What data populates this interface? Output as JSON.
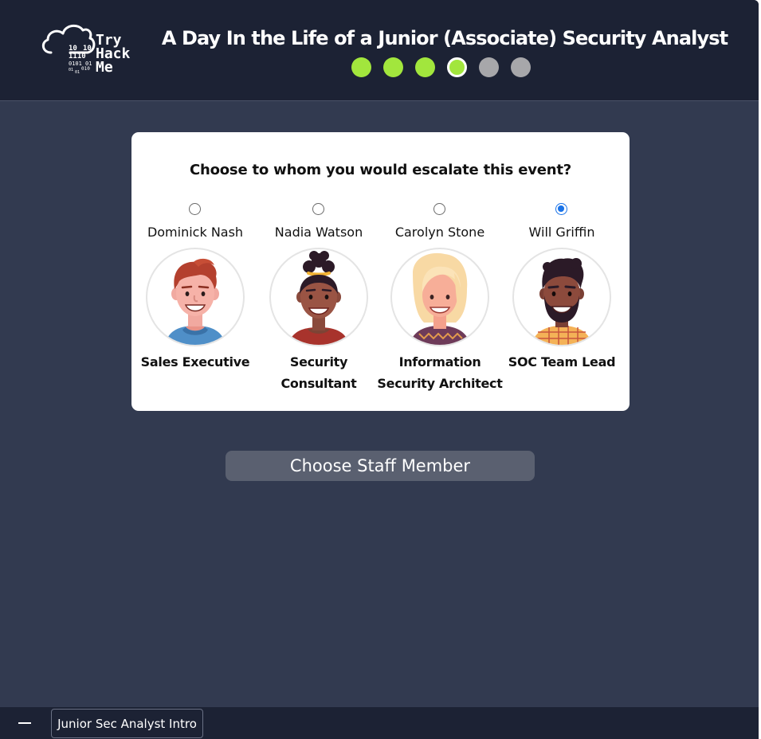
{
  "app": {
    "title": "A Day In the Life of a Junior (Associate) Security Analyst",
    "logo": {
      "brand_lines": [
        "Try",
        "Hack",
        "Me"
      ],
      "icon": "cloud-binary-logo"
    },
    "progress": {
      "total_steps": 6,
      "completed_steps": 3,
      "current_step": 4,
      "completed_color": "#a2e63d",
      "pending_color": "#a7a7aa"
    }
  },
  "card": {
    "question": "Choose to whom you would escalate this event?",
    "options": [
      {
        "name": "Dominick Nash",
        "role": "Sales Executive",
        "selected": false,
        "avatar_icon": "man-avatar-icon"
      },
      {
        "name": "Nadia Watson",
        "role": "Security Consultant",
        "selected": false,
        "avatar_icon": "woman-curly-hair-avatar-icon"
      },
      {
        "name": "Carolyn Stone",
        "role": "Information Security Architect",
        "selected": false,
        "avatar_icon": "woman-blonde-avatar-icon"
      },
      {
        "name": "Will Griffin",
        "role": "SOC Team Lead",
        "selected": true,
        "avatar_icon": "man-bearded-avatar-icon"
      }
    ]
  },
  "actions": {
    "choose_button": "Choose Staff Member"
  },
  "taskbar": {
    "minimize_icon": "minimize-icon",
    "tab_label": "Junior Sec Analyst Intro"
  },
  "colors": {
    "header_bg": "#1c2234",
    "body_bg": "#323a50",
    "button_bg": "#5a6070",
    "radio_accent": "#1a73e8"
  }
}
